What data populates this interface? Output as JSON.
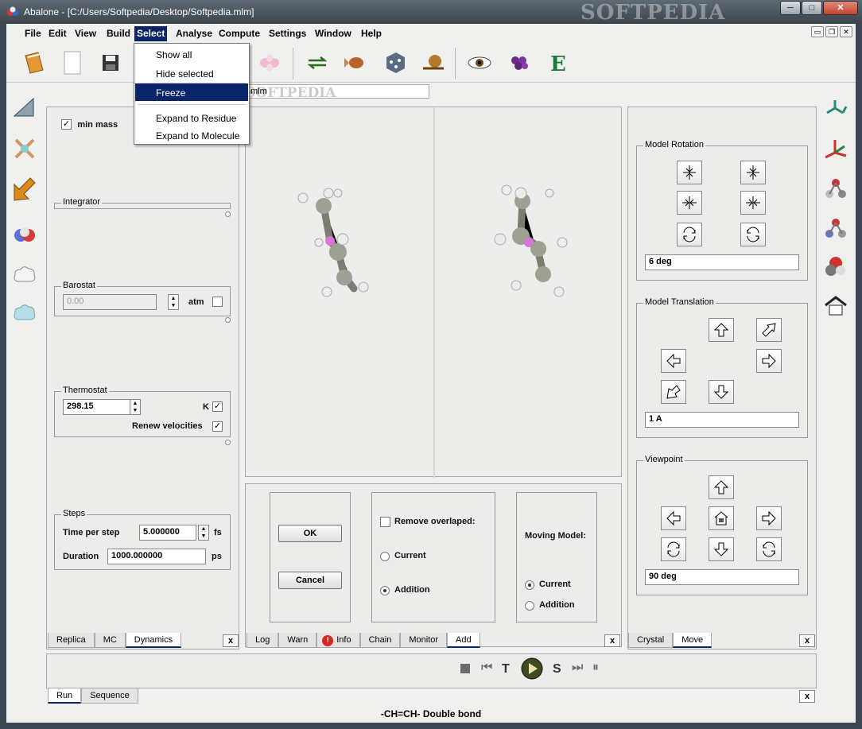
{
  "window": {
    "title": "Abalone - [C:/Users/Softpedia/Desktop/Softpedia.mlm]",
    "watermark": "SOFTPEDIA",
    "caption": {
      "minimize": "─",
      "maximize": "□",
      "close": "✕"
    }
  },
  "menubar": {
    "items": [
      "File",
      "Edit",
      "View",
      "Build",
      "Select",
      "Analyse",
      "Compute",
      "Settings",
      "Window",
      "Help"
    ],
    "active": "Select"
  },
  "select_menu": {
    "items": [
      "Show all",
      "Hide selected",
      "Freeze",
      "Expand to Residue",
      "Expand to Molecule"
    ],
    "highlighted": "Freeze",
    "highlight_color": "#0a246a"
  },
  "toolbar": {
    "icons": [
      "book-icon",
      "new-document-icon",
      "save-icon",
      "orbital-icon",
      "swap-arrows-icon",
      "fish-icon",
      "dice-icon",
      "snail-icon",
      "eye-icon",
      "grapes-icon",
      "energy-e-icon"
    ],
    "energy_letter": "E"
  },
  "document_tab": {
    "label": "mlm",
    "watermark": "SOFTPEDIA"
  },
  "left_panel": {
    "min_mass": {
      "label": "min mass",
      "checked": true
    },
    "integrator": {
      "title": "Integrator"
    },
    "barostat": {
      "title": "Barostat",
      "value": "0.00",
      "unit": "atm",
      "checked": false
    },
    "thermostat": {
      "title": "Thermostat",
      "value": "298.15",
      "unit": "K",
      "unit_checked": true,
      "renew_label": "Renew velocities",
      "renew_checked": true
    },
    "steps": {
      "title": "Steps",
      "time_label": "Time per step",
      "time_value": "5.000000",
      "time_unit": "fs",
      "duration_label": "Duration",
      "duration_value": "1000.000000",
      "duration_unit": "ps"
    },
    "tabs": [
      "Replica",
      "MC",
      "Dynamics"
    ],
    "active_tab": "Dynamics",
    "close": "x"
  },
  "center_panel": {
    "ok_label": "OK",
    "cancel_label": "Cancel",
    "remove_overlapped": {
      "label": "Remove overlaped:",
      "checked": false
    },
    "overlap_options": [
      "Current",
      "Addition"
    ],
    "overlap_selected": "Addition",
    "moving_model": {
      "label": "Moving Model:",
      "options": [
        "Current",
        "Addition"
      ],
      "selected": "Current"
    },
    "tabs": [
      "Log",
      "Warn",
      "Info",
      "Chain",
      "Monitor",
      "Add"
    ],
    "active_tab": "Add",
    "close": "x"
  },
  "right_panel": {
    "rotation": {
      "title": "Model Rotation",
      "value": "6 deg"
    },
    "translation": {
      "title": "Model Translation",
      "value": "1 A"
    },
    "viewpoint": {
      "title": "Viewpoint",
      "value": "90 deg"
    },
    "tabs": [
      "Crystal",
      "Move"
    ],
    "active_tab": "Move",
    "close": "x"
  },
  "bottom_panel": {
    "tabs": [
      "Run",
      "Sequence"
    ],
    "active_tab": "Run",
    "controls": [
      "stop-icon",
      "skip-back-icon",
      "T",
      "play-icon",
      "S",
      "skip-forward-icon",
      "pause-icon"
    ],
    "t_label": "T",
    "s_label": "S",
    "close": "x"
  },
  "status": {
    "text": "-CH=CH- Double bond"
  },
  "colors": {
    "menu_highlight": "#0a246a",
    "carbon": "#9ea093",
    "hydrogen": "#ececec",
    "double_bond": "#d877d8"
  }
}
